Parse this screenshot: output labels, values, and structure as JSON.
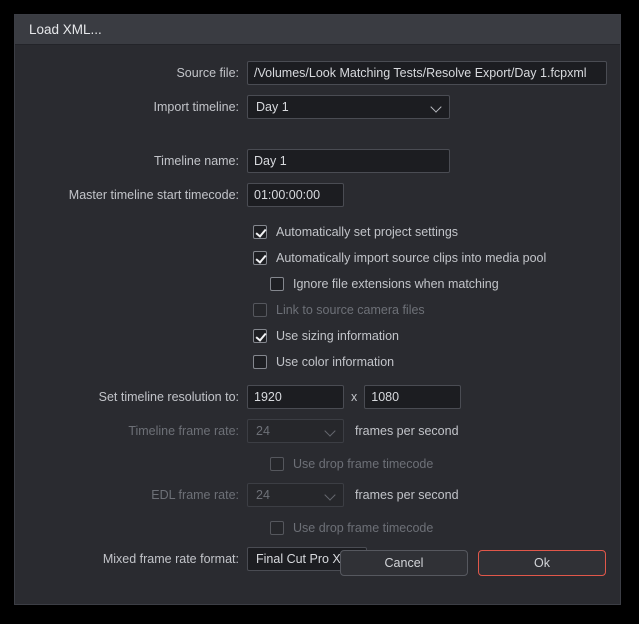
{
  "dialog": {
    "title": "Load XML..."
  },
  "fields": {
    "source_file_label": "Source file:",
    "source_file_value": "/Volumes/Look Matching Tests/Resolve Export/Day 1.fcpxml",
    "import_timeline_label": "Import timeline:",
    "import_timeline_value": "Day 1",
    "timeline_name_label": "Timeline name:",
    "timeline_name_value": "Day 1",
    "master_timecode_label": "Master timeline start timecode:",
    "master_timecode_value": "01:00:00:00",
    "resolution_label": "Set timeline resolution to:",
    "resolution_width": "1920",
    "resolution_separator": "x",
    "resolution_height": "1080",
    "timeline_frame_rate_label": "Timeline frame rate:",
    "timeline_frame_rate_value": "24",
    "timeline_frame_rate_suffix": "frames per second",
    "edl_frame_rate_label": "EDL frame rate:",
    "edl_frame_rate_value": "24",
    "edl_frame_rate_suffix": "frames per second",
    "mixed_frame_rate_label": "Mixed frame rate format:",
    "mixed_frame_rate_value": "Final Cut Pro X"
  },
  "checkboxes": {
    "auto_project_settings": "Automatically set project settings",
    "auto_import_clips": "Automatically import source clips into media pool",
    "ignore_extensions": "Ignore file extensions when matching",
    "link_camera_files": "Link to source camera files",
    "use_sizing": "Use sizing information",
    "use_color": "Use color information",
    "drop_frame_timeline": "Use drop frame timecode",
    "drop_frame_edl": "Use drop frame timecode"
  },
  "buttons": {
    "cancel": "Cancel",
    "ok": "Ok"
  },
  "colors": {
    "dialog_background": "#2a2b30",
    "titlebar": "#3a3c42",
    "field_background": "#1c1d21",
    "accent_ok": "#e1574a",
    "text": "#c2c4c9",
    "text_disabled": "#6d7077"
  }
}
